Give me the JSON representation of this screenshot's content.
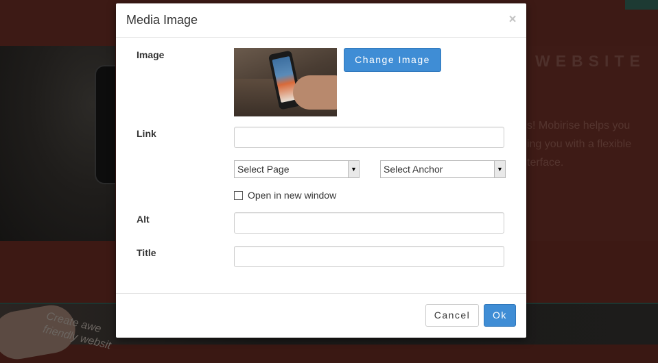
{
  "background": {
    "heading": "WEBSITE",
    "paragraph": "s! Mobirise helps you\ning you with a flexible\nterface.",
    "tilted_text": "Create awe\nfriendly websit"
  },
  "modal": {
    "title": "Media Image",
    "close_symbol": "×",
    "image_label": "Image",
    "change_image_button": "Change Image",
    "link_label": "Link",
    "link_value": "",
    "select_page": "Select Page",
    "select_anchor": "Select Anchor",
    "open_new_window_label": "Open in new window",
    "open_new_window_checked": false,
    "alt_label": "Alt",
    "alt_value": "",
    "title_label": "Title",
    "title_value": "",
    "cancel_button": "Cancel",
    "ok_button": "Ok"
  },
  "colors": {
    "primary": "#3f8dd5",
    "backdrop": "#3e1b16"
  },
  "icons": {
    "close": "close-icon",
    "select_arrow": "chevron-down-icon"
  }
}
